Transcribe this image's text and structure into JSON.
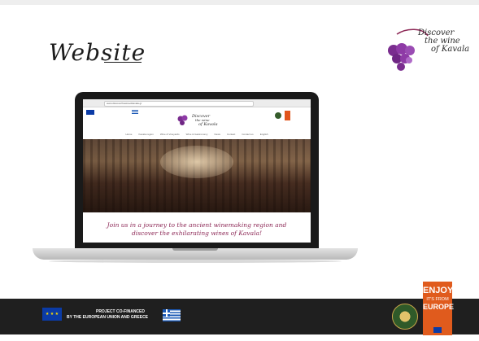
{
  "heading": {
    "title": "Website"
  },
  "brand": {
    "name": "Discover the wine of Kavala",
    "line1": "Discover",
    "line2": "the wine",
    "line3": "of Kavala"
  },
  "browser": {
    "url": "www.discoverthewineofkavala.gr"
  },
  "site": {
    "nav": [
      "Home",
      "Kavala region",
      "Wine & Vineyards",
      "Wine & Gastronomy",
      "News",
      "Contact",
      "Contact us",
      "English"
    ],
    "tagline_line1": "Join us in a journey to the ancient winemaking region and",
    "tagline_line2": "discover the exhilarating wines of Kavala!"
  },
  "footer": {
    "project_line1": "PROJECT CO-FINANCED",
    "project_line2": "BY THE EUROPEAN UNION AND GREECE",
    "enjoy_top": "ENJOY",
    "enjoy_mid": "IT'S FROM",
    "enjoy_bottom": "EUROPE"
  },
  "colors": {
    "accent": "#8c2755",
    "footer_bg": "#1f1f1f",
    "enjoy_bg": "#e05b1d",
    "eu_blue": "#0b3ba6"
  }
}
